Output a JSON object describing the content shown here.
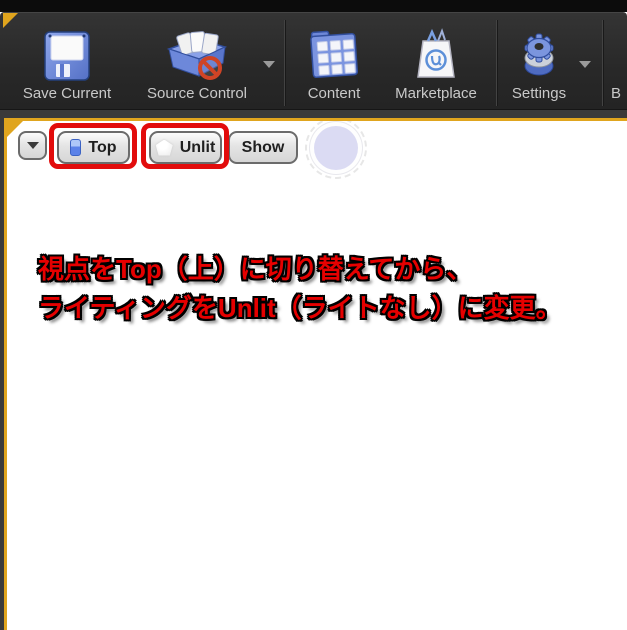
{
  "toolbar": {
    "items": [
      {
        "label": "Save Current",
        "icon": "floppy-disk-icon"
      },
      {
        "label": "Source Control",
        "icon": "source-control-box-icon",
        "dropdown": true
      },
      {
        "label": "Content",
        "icon": "content-browser-icon"
      },
      {
        "label": "Marketplace",
        "icon": "marketplace-bag-icon"
      },
      {
        "label": "Settings",
        "icon": "settings-gears-icon",
        "dropdown": true
      },
      {
        "label": "B",
        "icon": ""
      }
    ]
  },
  "viewport": {
    "toolbar": {
      "options_icon": "chevron-down-icon",
      "view_mode": "Top",
      "view_mode_icon": "top-view-icon",
      "lighting_mode": "Unlit",
      "lighting_mode_icon": "unlit-sphere-icon",
      "show_label": "Show"
    },
    "annotation": {
      "line1": "視点をTop（上）に切り替えてから、",
      "line2": "ライティングをUnlit（ライトなし）に変更。"
    }
  },
  "colors": {
    "highlight_red": "#e20c0c",
    "annotation_red": "#e60000",
    "selection_yellow": "#e0a51e",
    "toolbar_bg": "#2c2c2c",
    "viewport_bg": "#ffffff",
    "icon_blue": "#7b95de"
  }
}
